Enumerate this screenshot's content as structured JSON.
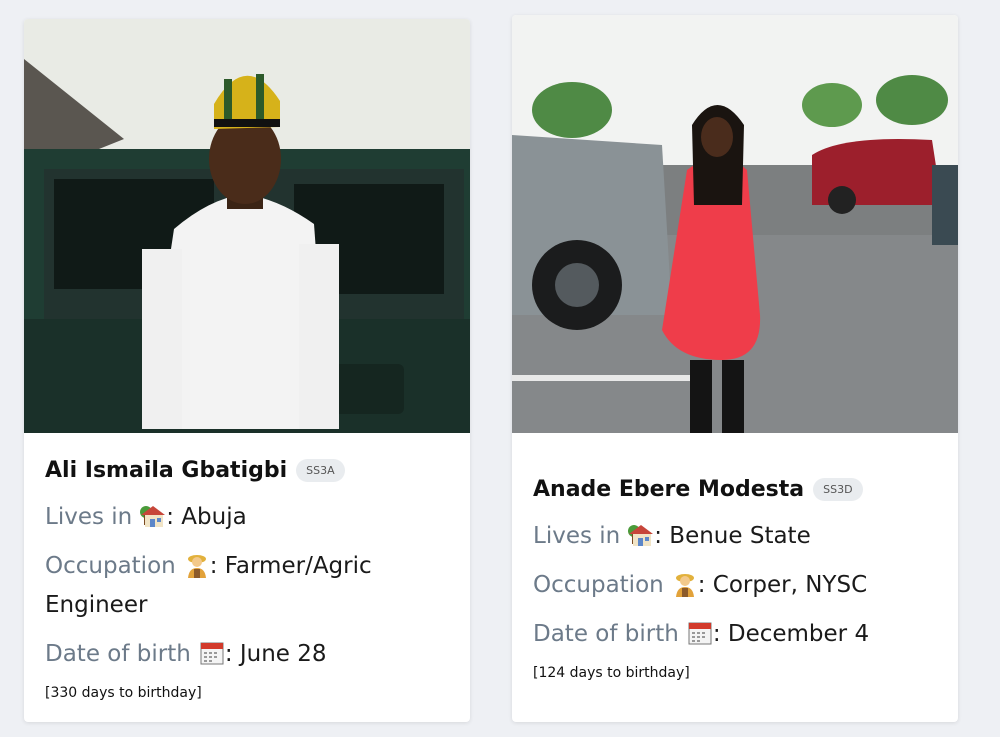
{
  "people": [
    {
      "name": "Ali Ismaila Gbatigbi",
      "class": "SS3A",
      "lives_label": "Lives in",
      "lives_value": ": Abuja",
      "occupation_label": "Occupation",
      "occupation_value": ": Farmer/Agric Engineer",
      "dob_label": "Date of birth",
      "dob_value": ": June 28",
      "days_to_birthday": "[330 days to birthday]"
    },
    {
      "name": "Anade Ebere Modesta",
      "class": "SS3D",
      "lives_label": "Lives in",
      "lives_value": ": Benue State",
      "occupation_label": "Occupation",
      "occupation_value": ": Corper, NYSC",
      "dob_label": "Date of birth",
      "dob_value": ": December 4",
      "days_to_birthday": "[124 days to birthday]"
    }
  ],
  "icons": {
    "lives": "house-with-garden-icon",
    "occupation": "farmer-person-icon",
    "dob": "calendar-icon"
  },
  "colors": {
    "label": "#6c7a89",
    "badge_bg": "#e9ecef",
    "page_bg": "#eef0f4"
  }
}
